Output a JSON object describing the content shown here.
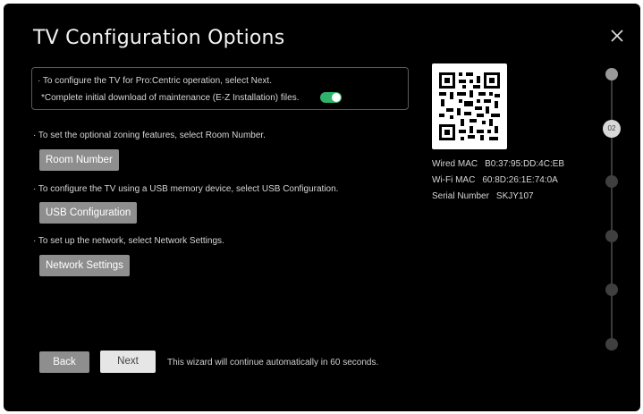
{
  "window": {
    "title": "TV Configuration Options"
  },
  "intro": {
    "line1": "· To configure the TV for Pro:Centric operation, select Next.",
    "line2": "*Complete initial download of maintenance (E-Z Installation) files.",
    "toggle_on": true,
    "toggle_color": "#2fb36b"
  },
  "sections": {
    "room": {
      "desc": "· To set the optional zoning features, select Room Number.",
      "button": "Room Number"
    },
    "usb": {
      "desc": "· To configure the TV using a USB memory device, select USB Configuration.",
      "button": "USB Configuration"
    },
    "network": {
      "desc": "· To set up the network, select Network Settings.",
      "button": "Network Settings"
    }
  },
  "footer": {
    "back": "Back",
    "next": "Next",
    "note": "This wizard will continue automatically in 60 seconds."
  },
  "device": {
    "wired_label": "Wired MAC",
    "wired_value": "B0:37:95:DD:4C:EB",
    "wifi_label": "Wi-Fi MAC",
    "wifi_value": "60:8D:26:1E:74:0A",
    "serial_label": "Serial Number",
    "serial_value": "SKJY107"
  },
  "progress": {
    "current_step": "02",
    "total_steps": 6
  },
  "icons": {
    "close": "close-icon",
    "qr": "qr-code"
  }
}
